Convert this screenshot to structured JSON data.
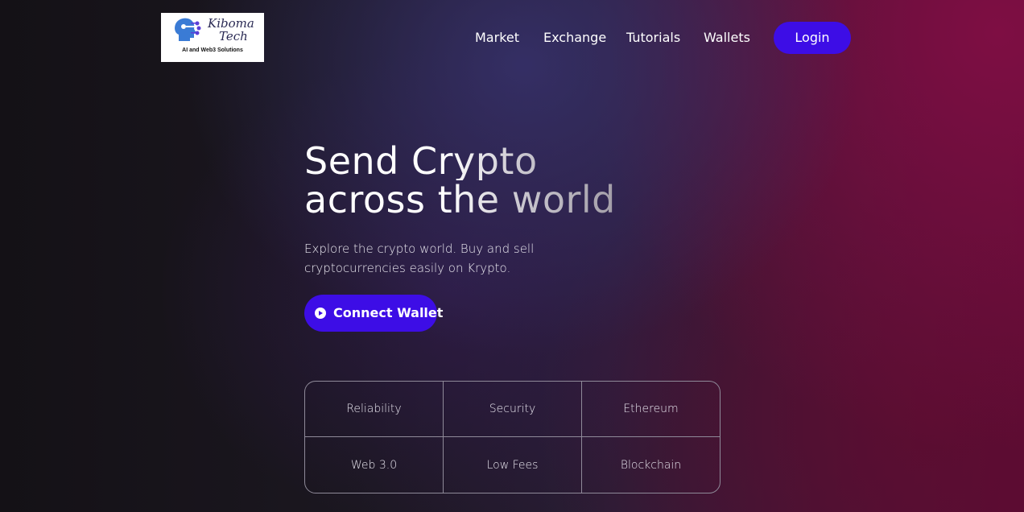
{
  "logo": {
    "brand_line1": "Kiboma",
    "brand_line2": "Tech",
    "tagline": "AI and Web3 Solutions"
  },
  "nav": {
    "items": [
      "Market",
      "Exchange",
      "Tutorials",
      "Wallets"
    ],
    "login_label": "Login"
  },
  "hero": {
    "headline_line1": "Send Crypto",
    "headline_line2": "across the world",
    "subtitle": "Explore the crypto world. Buy and sell cryptocurrencies easily on Krypto.",
    "connect_label": "Connect Wallet"
  },
  "features": [
    "Reliability",
    "Security",
    "Ethereum",
    "Web 3.0",
    "Low Fees",
    "Blockchain"
  ],
  "colors": {
    "accent": "#3d0de6",
    "background_dark": "#141116",
    "background_magenta": "#5a0c34"
  }
}
